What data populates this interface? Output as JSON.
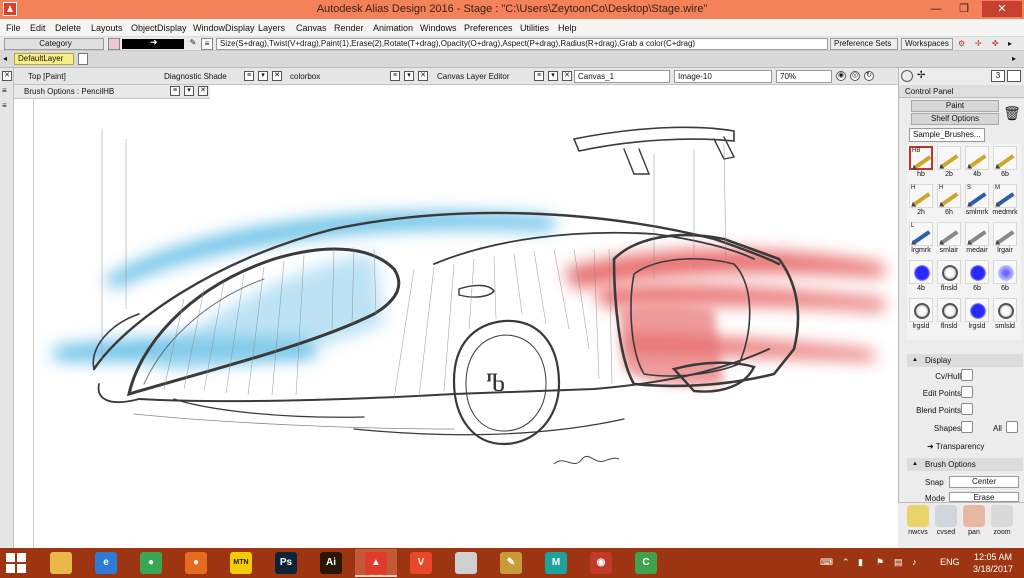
{
  "window": {
    "title": "Autodesk Alias Design 2016      - Stage : \"C:\\Users\\ZeytoonCo\\Desktop\\Stage.wire\"",
    "min_label": "—",
    "restore_label": "❐",
    "close_label": "✕"
  },
  "menu": [
    "File",
    "Edit",
    "Delete",
    "Layouts",
    "ObjectDisplay",
    "WindowDisplay",
    "Layers",
    "Canvas",
    "Render",
    "Animation",
    "Windows",
    "Preferences",
    "Utilities",
    "Help"
  ],
  "toolbar": {
    "category_label": "Category",
    "hint": "Size(S+drag),Twist(V+drag),Paint(1),Erase(2),Rotate(T+drag),Opacity(O+drag),Aspect(P+drag),Radius(R+drag),Grab a color(C+drag)",
    "preference_sets": "Preference Sets",
    "workspaces": "Workspaces"
  },
  "layers": {
    "default_layer": "DefaultLayer"
  },
  "panels": {
    "top_view": "Top [Paint]",
    "diagnostic": "Diagnostic Shade",
    "colorbox": "colorbox",
    "canvas_layer_editor": "Canvas Layer Editor",
    "canvas_name": "Canvas_1",
    "image_name": "Image-10",
    "zoom": "70%",
    "page_count": "3"
  },
  "brush_options": {
    "title": "Brush Options : PencilHB"
  },
  "control_panel": {
    "title": "Control Panel",
    "paint": "Paint",
    "shelf_options": "Shelf Options",
    "shelf_tab": "Sample_Brushes...",
    "brushes": [
      {
        "label": "hb",
        "kind": "pencil",
        "tag": "HB"
      },
      {
        "label": "2b",
        "kind": "pencil",
        "tag": ""
      },
      {
        "label": "4b",
        "kind": "pencil",
        "tag": ""
      },
      {
        "label": "6b",
        "kind": "pencil",
        "tag": ""
      },
      {
        "label": "2h",
        "kind": "pencil",
        "tag": "H"
      },
      {
        "label": "6h",
        "kind": "pencil",
        "tag": "H"
      },
      {
        "label": "smlmrk",
        "kind": "marker",
        "tag": "S"
      },
      {
        "label": "medmrk",
        "kind": "marker",
        "tag": "M"
      },
      {
        "label": "lrgmrk",
        "kind": "marker",
        "tag": "L"
      },
      {
        "label": "smlair",
        "kind": "air",
        "tag": ""
      },
      {
        "label": "medair",
        "kind": "air",
        "tag": ""
      },
      {
        "label": "lrgair",
        "kind": "air",
        "tag": ""
      },
      {
        "label": "4b",
        "kind": "blue",
        "tag": ""
      },
      {
        "label": "flnsld",
        "kind": "ring",
        "tag": ""
      },
      {
        "label": "6b",
        "kind": "blue",
        "tag": ""
      },
      {
        "label": "6b",
        "kind": "softblue",
        "tag": ""
      },
      {
        "label": "lrgsld",
        "kind": "ring",
        "tag": ""
      },
      {
        "label": "flnsld",
        "kind": "ring",
        "tag": ""
      },
      {
        "label": "lrgsld",
        "kind": "blue",
        "tag": ""
      },
      {
        "label": "smlsld",
        "kind": "ring",
        "tag": ""
      }
    ],
    "display": {
      "title": "Display",
      "cv_hull": "Cv/Hull",
      "edit_points": "Edit Points",
      "blend_points": "Blend Points",
      "shapes": "Shapes",
      "all": "All",
      "transparency": "Transparency"
    },
    "brush_options_section": {
      "title": "Brush Options",
      "snap_label": "Snap",
      "snap_value": "Center",
      "mode_label": "Mode",
      "mode_value": "Erase"
    },
    "tools": [
      {
        "label": "nwcvs",
        "color": "#e9d36a"
      },
      {
        "label": "cvsed",
        "color": "#cfd6dc"
      },
      {
        "label": "pan",
        "color": "#e7b9a5"
      },
      {
        "label": "zoom",
        "color": "#d9d9d9"
      }
    ]
  },
  "taskbar": {
    "apps": [
      {
        "name": "file-explorer",
        "color": "#e9b84a",
        "glyph": ""
      },
      {
        "name": "internet-explorer",
        "color": "#2c7bd6",
        "glyph": "e"
      },
      {
        "name": "chrome",
        "color": "#3aa757",
        "glyph": "●"
      },
      {
        "name": "firefox",
        "color": "#e66a1f",
        "glyph": "●"
      },
      {
        "name": "mtn",
        "color": "#f2cb05",
        "glyph": "MTN"
      },
      {
        "name": "photoshop",
        "color": "#0d2436",
        "glyph": "Ps"
      },
      {
        "name": "illustrator",
        "color": "#2b1504",
        "glyph": "Ai"
      },
      {
        "name": "alias",
        "color": "#e03a2a",
        "glyph": "▲"
      },
      {
        "name": "vectr",
        "color": "#e9472a",
        "glyph": "V"
      },
      {
        "name": "portrait",
        "color": "#cfcfcf",
        "glyph": ""
      },
      {
        "name": "pencil",
        "color": "#c79a3a",
        "glyph": "✎"
      },
      {
        "name": "maya",
        "color": "#1aa39b",
        "glyph": "M"
      },
      {
        "name": "sketchbook",
        "color": "#c0392b",
        "glyph": "◉"
      },
      {
        "name": "camtasia",
        "color": "#3fa34d",
        "glyph": "C"
      }
    ],
    "lang": "ENG",
    "time": "12:05 AM",
    "date": "3/18/2017"
  },
  "colors": {
    "title_bar": "#f3825a",
    "taskbar": "#9e3512",
    "blue_streak": "#4fb6e3",
    "red_streak": "#e44a4a"
  }
}
